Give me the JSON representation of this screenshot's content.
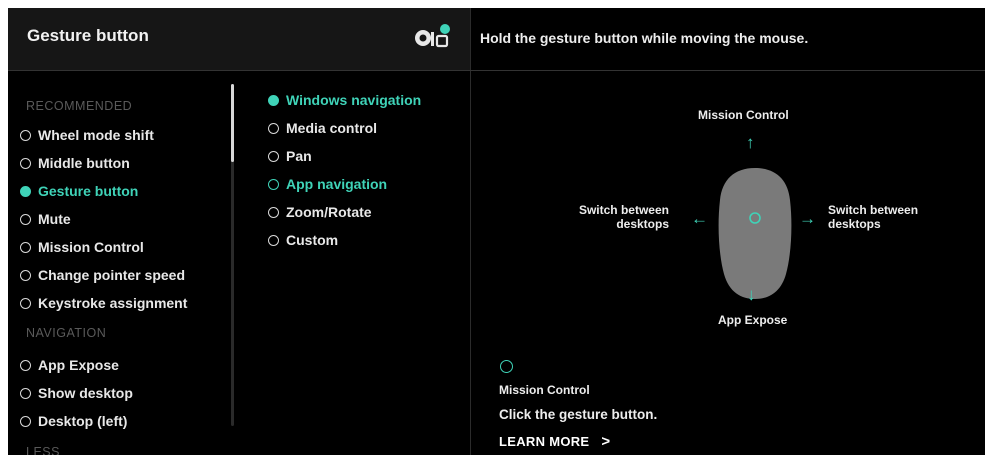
{
  "header": {
    "title": "Gesture button",
    "instruction": "Hold the gesture button while moving the mouse.",
    "icon": "device-settings-icon"
  },
  "left_list": {
    "recommended_heading": "RECOMMENDED",
    "recommended": [
      {
        "label": "Wheel mode shift",
        "selected": false
      },
      {
        "label": "Middle button",
        "selected": false
      },
      {
        "label": "Gesture button",
        "selected": true
      },
      {
        "label": "Mute",
        "selected": false
      },
      {
        "label": "Mission Control",
        "selected": false
      },
      {
        "label": "Change pointer speed",
        "selected": false
      },
      {
        "label": "Keystroke assignment",
        "selected": false
      }
    ],
    "navigation_heading": "NAVIGATION",
    "navigation": [
      {
        "label": "App Expose",
        "selected": false
      },
      {
        "label": "Show desktop",
        "selected": false
      },
      {
        "label": "Desktop (left)",
        "selected": false
      }
    ],
    "less_label": "LESS"
  },
  "mid_list": [
    {
      "label": "Windows navigation",
      "selected": true
    },
    {
      "label": "Media control",
      "selected": false
    },
    {
      "label": "Pan",
      "selected": false
    },
    {
      "label": "App navigation",
      "selected": false,
      "highlighted": true
    },
    {
      "label": "Zoom/Rotate",
      "selected": false
    },
    {
      "label": "Custom",
      "selected": false
    }
  ],
  "gesture_diagram": {
    "up": "Mission Control",
    "down": "App Expose",
    "left": "Switch between desktops",
    "left_lines": [
      "Switch between",
      "desktops"
    ],
    "right": "Switch between desktops",
    "right_lines": [
      "Switch between",
      "desktops"
    ]
  },
  "detail": {
    "title": "Mission Control",
    "description": "Click the gesture button.",
    "learn_more": "LEARN MORE",
    "learn_more_chevron": ">"
  },
  "colors": {
    "accent": "#3fd3b8",
    "background": "#000000",
    "header_bg": "#161616",
    "mouse_body": "#7a7a7a"
  }
}
